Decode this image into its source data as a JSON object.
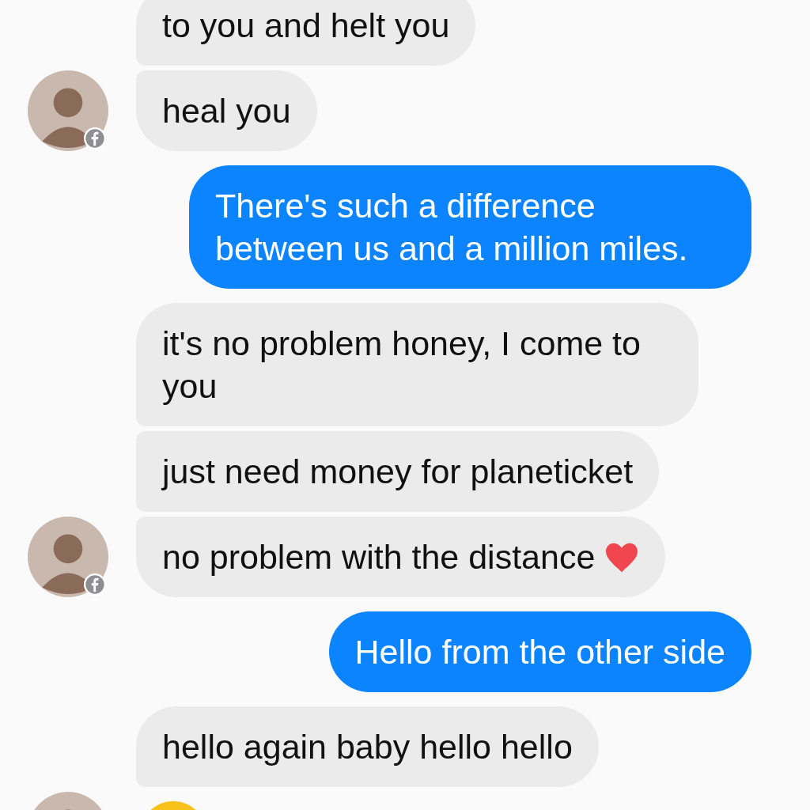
{
  "messages": [
    {
      "kind": "received",
      "text": "to you and helt you",
      "avatar": false,
      "heart": false
    },
    {
      "kind": "received",
      "text": "heal you",
      "avatar": true,
      "heart": false
    },
    {
      "kind": "sent",
      "text": "There's such a difference between us and a million miles.",
      "avatar": false,
      "heart": false
    },
    {
      "kind": "received",
      "text": "it's no problem honey, I come to you",
      "avatar": false,
      "heart": false
    },
    {
      "kind": "received",
      "text": "just need money for planeticket",
      "avatar": false,
      "heart": false
    },
    {
      "kind": "received",
      "text": "no problem with the distance",
      "avatar": true,
      "heart": true
    },
    {
      "kind": "sent",
      "text": "Hello from the other side",
      "avatar": false,
      "heart": false
    },
    {
      "kind": "received",
      "text": "hello again baby hello hello",
      "avatar": false,
      "heart": false
    },
    {
      "kind": "emoji",
      "avatar": true,
      "heart": false
    }
  ]
}
